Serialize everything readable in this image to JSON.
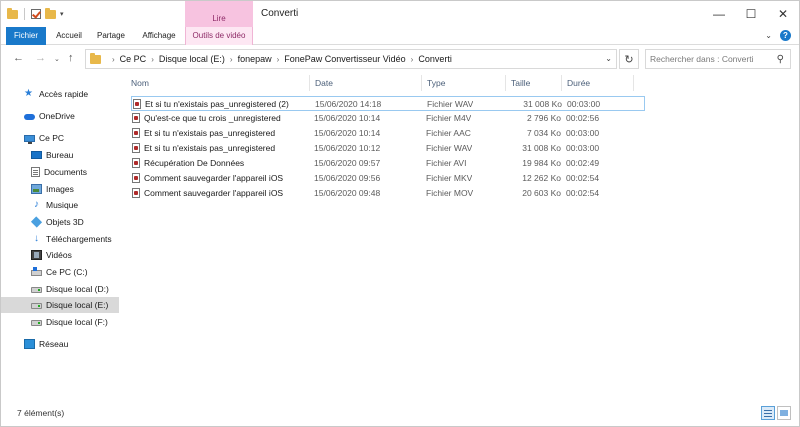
{
  "window": {
    "title": "Converti",
    "context_tab_top": "Lire"
  },
  "ribbon": {
    "tabs": [
      {
        "label": "Fichier"
      },
      {
        "label": "Accueil"
      },
      {
        "label": "Partage"
      },
      {
        "label": "Affichage"
      },
      {
        "label": "Outils de vidéo"
      }
    ]
  },
  "address": {
    "breadcrumbs": [
      "Ce PC",
      "Disque local (E:)",
      "fonepaw",
      "FonePaw Convertisseur Vidéo",
      "Converti"
    ]
  },
  "search": {
    "placeholder": "Rechercher dans : Converti"
  },
  "navpane": {
    "items": [
      {
        "label": "Accès rapide",
        "icon": "star-icon"
      },
      {
        "label": "OneDrive",
        "icon": "cloud-icon"
      },
      {
        "label": "Ce PC",
        "icon": "computer-icon"
      },
      {
        "label": "Bureau",
        "icon": "desktop-icon"
      },
      {
        "label": "Documents",
        "icon": "document-icon"
      },
      {
        "label": "Images",
        "icon": "image-icon"
      },
      {
        "label": "Musique",
        "icon": "music-icon"
      },
      {
        "label": "Objets 3D",
        "icon": "cube-icon"
      },
      {
        "label": "Téléchargements",
        "icon": "download-icon"
      },
      {
        "label": "Vidéos",
        "icon": "video-icon"
      },
      {
        "label": "Ce PC (C:)",
        "icon": "system-drive-icon"
      },
      {
        "label": "Disque local (D:)",
        "icon": "drive-icon"
      },
      {
        "label": "Disque local (E:)",
        "icon": "drive-icon"
      },
      {
        "label": "Disque local (F:)",
        "icon": "drive-icon"
      },
      {
        "label": "Réseau",
        "icon": "network-icon"
      }
    ]
  },
  "files": {
    "columns": [
      "Nom",
      "Date",
      "Type",
      "Taille",
      "Durée"
    ],
    "rows": [
      {
        "name": "Et si tu n'existais pas_unregistered (2)",
        "date": "15/06/2020 14:18",
        "type": "Fichier WAV",
        "size": "31 008 Ko",
        "duration": "00:03:00"
      },
      {
        "name": "Qu'est-ce que tu crois _unregistered",
        "date": "15/06/2020 10:14",
        "type": "Fichier M4V",
        "size": "2 796 Ko",
        "duration": "00:02:56"
      },
      {
        "name": "Et si tu n'existais pas_unregistered",
        "date": "15/06/2020 10:14",
        "type": "Fichier AAC",
        "size": "7 034 Ko",
        "duration": "00:03:00"
      },
      {
        "name": "Et si tu n'existais pas_unregistered",
        "date": "15/06/2020 10:12",
        "type": "Fichier WAV",
        "size": "31 008 Ko",
        "duration": "00:03:00"
      },
      {
        "name": "Récupération De Données",
        "date": "15/06/2020 09:57",
        "type": "Fichier AVI",
        "size": "19 984 Ko",
        "duration": "00:02:49"
      },
      {
        "name": "Comment sauvegarder l'appareil iOS",
        "date": "15/06/2020 09:56",
        "type": "Fichier MKV",
        "size": "12 262 Ko",
        "duration": "00:02:54"
      },
      {
        "name": "Comment sauvegarder l'appareil iOS",
        "date": "15/06/2020 09:48",
        "type": "Fichier MOV",
        "size": "20 603 Ko",
        "duration": "00:02:54"
      }
    ]
  },
  "status": {
    "item_count": "7 élément(s)"
  },
  "colors": {
    "accent": "#1979ca",
    "context_tab": "#f7c3e0",
    "selection": "#d9d9d9"
  }
}
